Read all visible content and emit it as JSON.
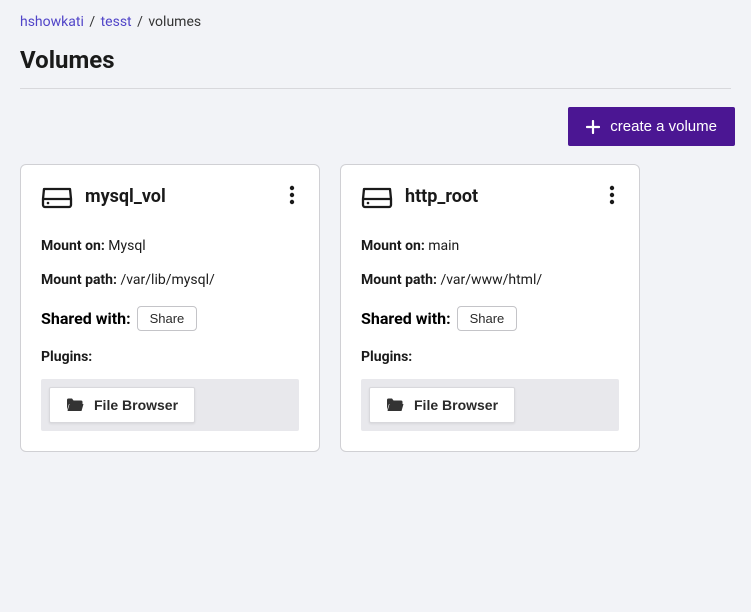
{
  "breadcrumb": {
    "parts": [
      {
        "label": "hshowkati",
        "link": true
      },
      {
        "label": "tesst",
        "link": true
      }
    ],
    "current": "volumes"
  },
  "page": {
    "title": "Volumes"
  },
  "actions": {
    "create_label": "create a volume"
  },
  "labels": {
    "mount_on": "Mount on:",
    "mount_path": "Mount path:",
    "shared_with": "Shared with:",
    "plugins": "Plugins:",
    "share_btn": "Share",
    "file_browser": "File Browser"
  },
  "volumes": [
    {
      "name": "mysql_vol",
      "mount_on": "Mysql",
      "mount_path": "/var/lib/mysql/"
    },
    {
      "name": "http_root",
      "mount_on": "main",
      "mount_path": "/var/www/html/"
    }
  ]
}
